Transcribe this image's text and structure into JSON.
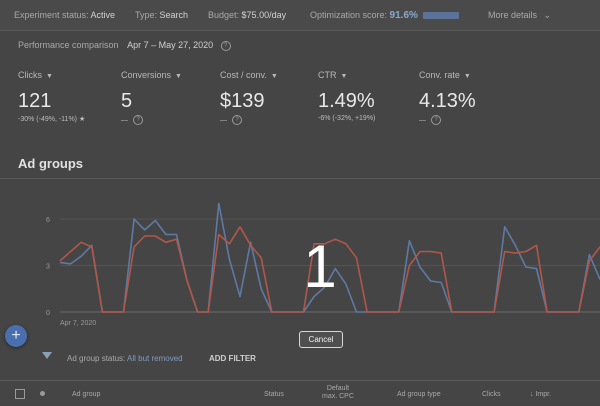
{
  "statusbar": {
    "experiment_label": "Experiment status:",
    "experiment_value": "Active",
    "type_label": "Type:",
    "type_value": "Search",
    "budget_label": "Budget:",
    "budget_value": "$75.00/day",
    "optscore_label": "Optimization score:",
    "optscore_value": "91.6%",
    "more_details": "More details"
  },
  "performance": {
    "label": "Performance comparison",
    "range": "Apr 7 – May 27, 2020"
  },
  "metrics": [
    {
      "name": "Clicks",
      "value": "121",
      "delta": "-30% (-49%, -11%) ★"
    },
    {
      "name": "Conversions",
      "value": "5",
      "delta": "—"
    },
    {
      "name": "Cost / conv.",
      "value": "$139",
      "delta": "—"
    },
    {
      "name": "CTR",
      "value": "1.49%",
      "delta": "-6% (-32%, +19%)"
    },
    {
      "name": "Conv. rate",
      "value": "4.13%",
      "delta": "—"
    }
  ],
  "section_title": "Ad groups",
  "chart_data": {
    "type": "line",
    "x_label_start": "Apr 7, 2020",
    "y_ticks": [
      0,
      3,
      6
    ],
    "ylim": [
      0,
      6
    ],
    "series": [
      {
        "color": "#5d7aa4",
        "values": [
          3.2,
          3.1,
          3.6,
          4.3,
          0,
          0,
          0,
          6,
          5.3,
          5.9,
          5,
          5,
          2,
          0,
          0,
          7,
          3.4,
          1,
          4.5,
          1.5,
          0,
          0,
          0,
          0,
          1,
          1.6,
          2.8,
          1.8,
          0,
          0,
          0,
          0,
          0,
          4.6,
          2.9,
          2,
          1.9,
          0,
          0,
          0,
          0,
          0,
          5.5,
          4.3,
          2.9,
          2.8,
          0,
          0,
          0,
          0,
          3.7,
          2.1
        ]
      },
      {
        "color": "#b0574a",
        "values": [
          3.3,
          3.9,
          4.5,
          4.2,
          0,
          0,
          0,
          4.2,
          4.9,
          4.9,
          4.5,
          4.7,
          2,
          0,
          0,
          5,
          4.4,
          5.5,
          4.3,
          3.5,
          0,
          0,
          0,
          0,
          4.4,
          4.4,
          4.7,
          4.4,
          3.5,
          0,
          0,
          0,
          0,
          3,
          3.9,
          3.9,
          3.8,
          0,
          0,
          0,
          0,
          0,
          3.9,
          3.8,
          3.9,
          4.3,
          0,
          0,
          0,
          0,
          3.3,
          4.2
        ]
      }
    ]
  },
  "filter": {
    "status_label": "Ad group status:",
    "status_value": "All but removed",
    "add_filter": "ADD FILTER"
  },
  "table_headers": {
    "ad_group": "Ad group",
    "status": "Status",
    "default_cpc_line1": "Default",
    "default_cpc_line2": "max. CPC",
    "ad_group_type": "Ad group type",
    "clicks": "Clicks",
    "impr": "Impr."
  },
  "overlay": {
    "countdown": "1",
    "cancel_label": "Cancel"
  },
  "fab_label": "+"
}
